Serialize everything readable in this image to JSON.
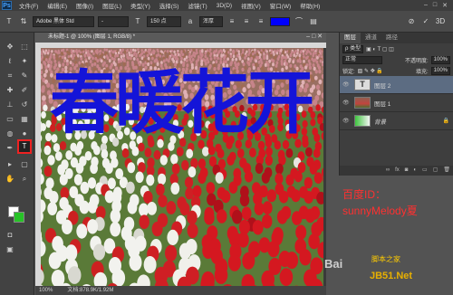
{
  "app": {
    "logo": "Ps"
  },
  "menu": [
    "文件(F)",
    "编辑(E)",
    "图像(I)",
    "图层(L)",
    "类型(Y)",
    "选择(S)",
    "滤镜(T)",
    "3D(D)",
    "视图(V)",
    "窗口(W)",
    "帮助(H)"
  ],
  "options_bar": {
    "font_family": "Adobe 黑体 Std",
    "font_style": "-",
    "font_size": "150 点",
    "antialias": "浑厚",
    "text_color": "#0000ff"
  },
  "document": {
    "tab_title": "未标题-1 @ 100% (图层 1, RGB/8) *",
    "headline": "春暖花开",
    "headline_color": "#1414d8",
    "zoom": "100%",
    "doc_info": "文档:878.9K/1.92M"
  },
  "layers_panel": {
    "tabs": [
      "图层",
      "通道",
      "路径"
    ],
    "kind_label": "ρ 类型",
    "blend_mode": "正常",
    "opacity_label": "不透明度:",
    "opacity_value": "100%",
    "lock_label": "锁定:",
    "fill_label": "填充:",
    "fill_value": "100%",
    "layers": [
      {
        "name": "图层 2",
        "type": "text"
      },
      {
        "name": "图层 1",
        "type": "image"
      },
      {
        "name": "背景",
        "type": "background"
      }
    ]
  },
  "overlay": {
    "id_line": "百度ID：",
    "user_line": "sunnyMelody夏",
    "baidu": "Bai",
    "baidu_sub": "脚本之家",
    "site": "JB51.Net"
  }
}
